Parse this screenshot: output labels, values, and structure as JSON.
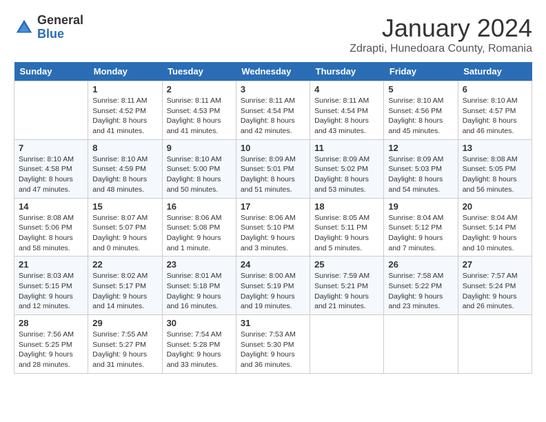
{
  "header": {
    "logo_line1": "General",
    "logo_line2": "Blue",
    "month_title": "January 2024",
    "subtitle": "Zdrapti, Hunedoara County, Romania"
  },
  "days_of_week": [
    "Sunday",
    "Monday",
    "Tuesday",
    "Wednesday",
    "Thursday",
    "Friday",
    "Saturday"
  ],
  "weeks": [
    [
      {
        "day": "",
        "info": ""
      },
      {
        "day": "1",
        "info": "Sunrise: 8:11 AM\nSunset: 4:52 PM\nDaylight: 8 hours\nand 41 minutes."
      },
      {
        "day": "2",
        "info": "Sunrise: 8:11 AM\nSunset: 4:53 PM\nDaylight: 8 hours\nand 41 minutes."
      },
      {
        "day": "3",
        "info": "Sunrise: 8:11 AM\nSunset: 4:54 PM\nDaylight: 8 hours\nand 42 minutes."
      },
      {
        "day": "4",
        "info": "Sunrise: 8:11 AM\nSunset: 4:54 PM\nDaylight: 8 hours\nand 43 minutes."
      },
      {
        "day": "5",
        "info": "Sunrise: 8:10 AM\nSunset: 4:56 PM\nDaylight: 8 hours\nand 45 minutes."
      },
      {
        "day": "6",
        "info": "Sunrise: 8:10 AM\nSunset: 4:57 PM\nDaylight: 8 hours\nand 46 minutes."
      }
    ],
    [
      {
        "day": "7",
        "info": "Sunrise: 8:10 AM\nSunset: 4:58 PM\nDaylight: 8 hours\nand 47 minutes."
      },
      {
        "day": "8",
        "info": "Sunrise: 8:10 AM\nSunset: 4:59 PM\nDaylight: 8 hours\nand 48 minutes."
      },
      {
        "day": "9",
        "info": "Sunrise: 8:10 AM\nSunset: 5:00 PM\nDaylight: 8 hours\nand 50 minutes."
      },
      {
        "day": "10",
        "info": "Sunrise: 8:09 AM\nSunset: 5:01 PM\nDaylight: 8 hours\nand 51 minutes."
      },
      {
        "day": "11",
        "info": "Sunrise: 8:09 AM\nSunset: 5:02 PM\nDaylight: 8 hours\nand 53 minutes."
      },
      {
        "day": "12",
        "info": "Sunrise: 8:09 AM\nSunset: 5:03 PM\nDaylight: 8 hours\nand 54 minutes."
      },
      {
        "day": "13",
        "info": "Sunrise: 8:08 AM\nSunset: 5:05 PM\nDaylight: 8 hours\nand 56 minutes."
      }
    ],
    [
      {
        "day": "14",
        "info": "Sunrise: 8:08 AM\nSunset: 5:06 PM\nDaylight: 8 hours\nand 58 minutes."
      },
      {
        "day": "15",
        "info": "Sunrise: 8:07 AM\nSunset: 5:07 PM\nDaylight: 9 hours\nand 0 minutes."
      },
      {
        "day": "16",
        "info": "Sunrise: 8:06 AM\nSunset: 5:08 PM\nDaylight: 9 hours\nand 1 minute."
      },
      {
        "day": "17",
        "info": "Sunrise: 8:06 AM\nSunset: 5:10 PM\nDaylight: 9 hours\nand 3 minutes."
      },
      {
        "day": "18",
        "info": "Sunrise: 8:05 AM\nSunset: 5:11 PM\nDaylight: 9 hours\nand 5 minutes."
      },
      {
        "day": "19",
        "info": "Sunrise: 8:04 AM\nSunset: 5:12 PM\nDaylight: 9 hours\nand 7 minutes."
      },
      {
        "day": "20",
        "info": "Sunrise: 8:04 AM\nSunset: 5:14 PM\nDaylight: 9 hours\nand 10 minutes."
      }
    ],
    [
      {
        "day": "21",
        "info": "Sunrise: 8:03 AM\nSunset: 5:15 PM\nDaylight: 9 hours\nand 12 minutes."
      },
      {
        "day": "22",
        "info": "Sunrise: 8:02 AM\nSunset: 5:17 PM\nDaylight: 9 hours\nand 14 minutes."
      },
      {
        "day": "23",
        "info": "Sunrise: 8:01 AM\nSunset: 5:18 PM\nDaylight: 9 hours\nand 16 minutes."
      },
      {
        "day": "24",
        "info": "Sunrise: 8:00 AM\nSunset: 5:19 PM\nDaylight: 9 hours\nand 19 minutes."
      },
      {
        "day": "25",
        "info": "Sunrise: 7:59 AM\nSunset: 5:21 PM\nDaylight: 9 hours\nand 21 minutes."
      },
      {
        "day": "26",
        "info": "Sunrise: 7:58 AM\nSunset: 5:22 PM\nDaylight: 9 hours\nand 23 minutes."
      },
      {
        "day": "27",
        "info": "Sunrise: 7:57 AM\nSunset: 5:24 PM\nDaylight: 9 hours\nand 26 minutes."
      }
    ],
    [
      {
        "day": "28",
        "info": "Sunrise: 7:56 AM\nSunset: 5:25 PM\nDaylight: 9 hours\nand 28 minutes."
      },
      {
        "day": "29",
        "info": "Sunrise: 7:55 AM\nSunset: 5:27 PM\nDaylight: 9 hours\nand 31 minutes."
      },
      {
        "day": "30",
        "info": "Sunrise: 7:54 AM\nSunset: 5:28 PM\nDaylight: 9 hours\nand 33 minutes."
      },
      {
        "day": "31",
        "info": "Sunrise: 7:53 AM\nSunset: 5:30 PM\nDaylight: 9 hours\nand 36 minutes."
      },
      {
        "day": "",
        "info": ""
      },
      {
        "day": "",
        "info": ""
      },
      {
        "day": "",
        "info": ""
      }
    ]
  ]
}
